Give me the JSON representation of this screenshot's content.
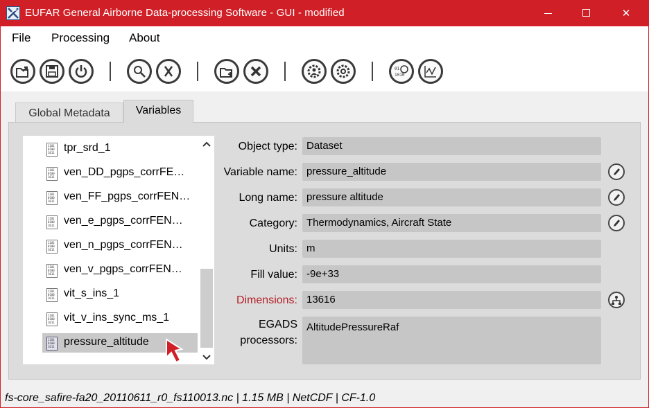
{
  "window": {
    "title": "EUFAR General Airborne Data-processing Software - GUI - modified",
    "title_color": "#d01f26",
    "controls": {
      "minimize_icon": "minimize-icon",
      "maximize_icon": "maximize-icon",
      "close_glyph": "✕"
    }
  },
  "menu": {
    "items": [
      "File",
      "Processing",
      "About"
    ]
  },
  "toolbar": {
    "buttons": [
      {
        "name": "open-file-icon"
      },
      {
        "name": "save-file-icon"
      },
      {
        "name": "power-icon"
      },
      {
        "name": "search-algorithm-icon"
      },
      {
        "name": "delete-algorithm-icon"
      },
      {
        "name": "add-folder-icon"
      },
      {
        "name": "remove-icon"
      },
      {
        "name": "user-settings-icon"
      },
      {
        "name": "settings-icon"
      },
      {
        "name": "binary-search-icon"
      },
      {
        "name": "plot-icon"
      }
    ]
  },
  "tabs": {
    "global_metadata": "Global Metadata",
    "variables": "Variables",
    "active": "Variables"
  },
  "variable_list": {
    "items": [
      "tpr_srd_1",
      "ven_DD_pgps_corrFE…",
      "ven_FF_pgps_corrFEN…",
      "ven_e_pgps_corrFEN…",
      "ven_n_pgps_corrFEN…",
      "ven_v_pgps_corrFEN…",
      "vit_s_ins_1",
      "vit_v_ins_sync_ms_1",
      "pressure_altitude"
    ],
    "selected": "pressure_altitude"
  },
  "details": {
    "object_type": {
      "label": "Object type:",
      "value": "Dataset"
    },
    "variable_name": {
      "label": "Variable name:",
      "value": "pressure_altitude"
    },
    "long_name": {
      "label": "Long name:",
      "value": "pressure altitude"
    },
    "category": {
      "label": "Category:",
      "value": "Thermodynamics, Aircraft State"
    },
    "units": {
      "label": "Units:",
      "value": "m"
    },
    "fill_value": {
      "label": "Fill value:",
      "value": "-9e+33"
    },
    "dimensions": {
      "label": "Dimensions:",
      "value": "13616",
      "label_color": "#b41e25"
    },
    "egads_processors": {
      "label_line1": "EGADS",
      "label_line2": "processors:",
      "value": "AltitudePressureRaf"
    }
  },
  "status": {
    "text": "fs-core_safire-fa20_20110611_r0_fs110013.nc  |  1.15 MB  |  NetCDF  |  CF-1.0"
  }
}
